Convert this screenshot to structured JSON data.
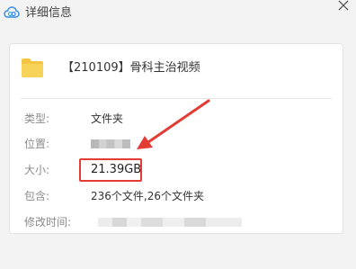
{
  "window": {
    "title": "详细信息",
    "app_icon": "cloud-icon",
    "close_icon": "close-icon"
  },
  "folder": {
    "icon": "folder-icon",
    "name": "【210109】骨科主治视频"
  },
  "properties": [
    {
      "label": "类型:",
      "value": "文件夹"
    },
    {
      "label": "位置:",
      "value": ""
    },
    {
      "label": "大小:",
      "value": "21.39GB"
    },
    {
      "label": "包含:",
      "value": "236个文件,26个文件夹"
    },
    {
      "label": "修改时间:",
      "value": ""
    }
  ],
  "colors": {
    "highlight": "#e23c34",
    "folder": "#f4c542"
  }
}
